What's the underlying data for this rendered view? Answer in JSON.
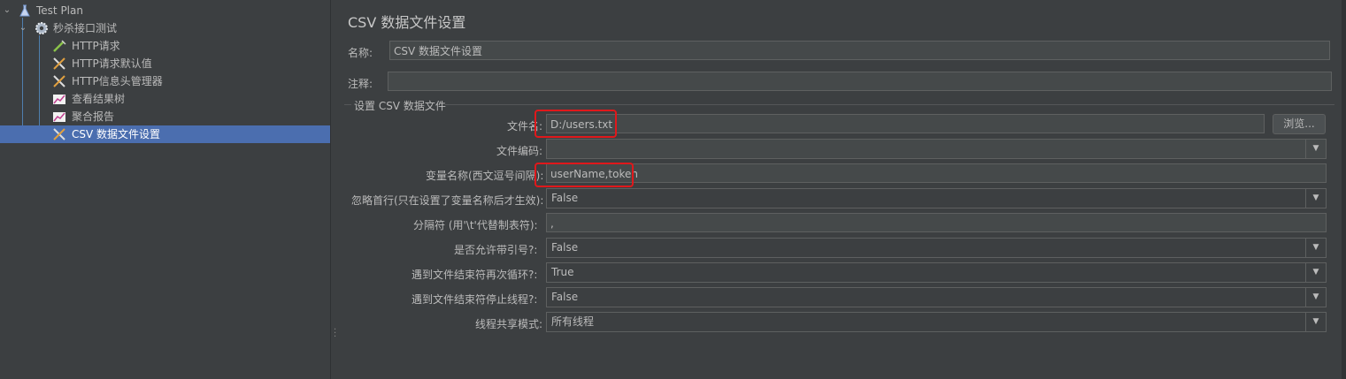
{
  "tree": {
    "items": [
      {
        "label": "Test Plan",
        "icon": "flask-icon"
      },
      {
        "label": "秒杀接口测试",
        "icon": "gear-icon"
      },
      {
        "label": "HTTP请求",
        "icon": "pipette-icon"
      },
      {
        "label": "HTTP请求默认值",
        "icon": "tools-icon"
      },
      {
        "label": "HTTP信息头管理器",
        "icon": "tools-icon"
      },
      {
        "label": "查看结果树",
        "icon": "chart-icon"
      },
      {
        "label": "聚合报告",
        "icon": "chart-icon"
      },
      {
        "label": "CSV 数据文件设置",
        "icon": "tools-icon"
      }
    ],
    "selected_index": 7
  },
  "panel": {
    "title": "CSV 数据文件设置",
    "name_label": "名称:",
    "name_value": "CSV 数据文件设置",
    "comment_label": "注释:",
    "comment_value": "",
    "group_title": "设置 CSV 数据文件",
    "file_label": "文件名:",
    "file_value": "D:/users.txt",
    "browse_label": "浏览...",
    "encoding_label": "文件编码:",
    "encoding_value": "",
    "varnames_label": "变量名称(西文逗号间隔):",
    "varnames_value": "userName,token",
    "ignore_first_label": "忽略首行(只在设置了变量名称后才生效):",
    "ignore_first_value": "False",
    "delimiter_label": "分隔符 (用'\\t'代替制表符):",
    "delimiter_value": ",",
    "quoted_label": "是否允许带引号?:",
    "quoted_value": "False",
    "recycle_label": "遇到文件结束符再次循环?:",
    "recycle_value": "True",
    "stop_label": "遇到文件结束符停止线程?:",
    "stop_value": "False",
    "share_label": "线程共享模式:",
    "share_value": "所有线程"
  },
  "colors": {
    "background": "#3c3f41",
    "selection": "#4b6eaf",
    "highlight_box": "#e0181b"
  }
}
